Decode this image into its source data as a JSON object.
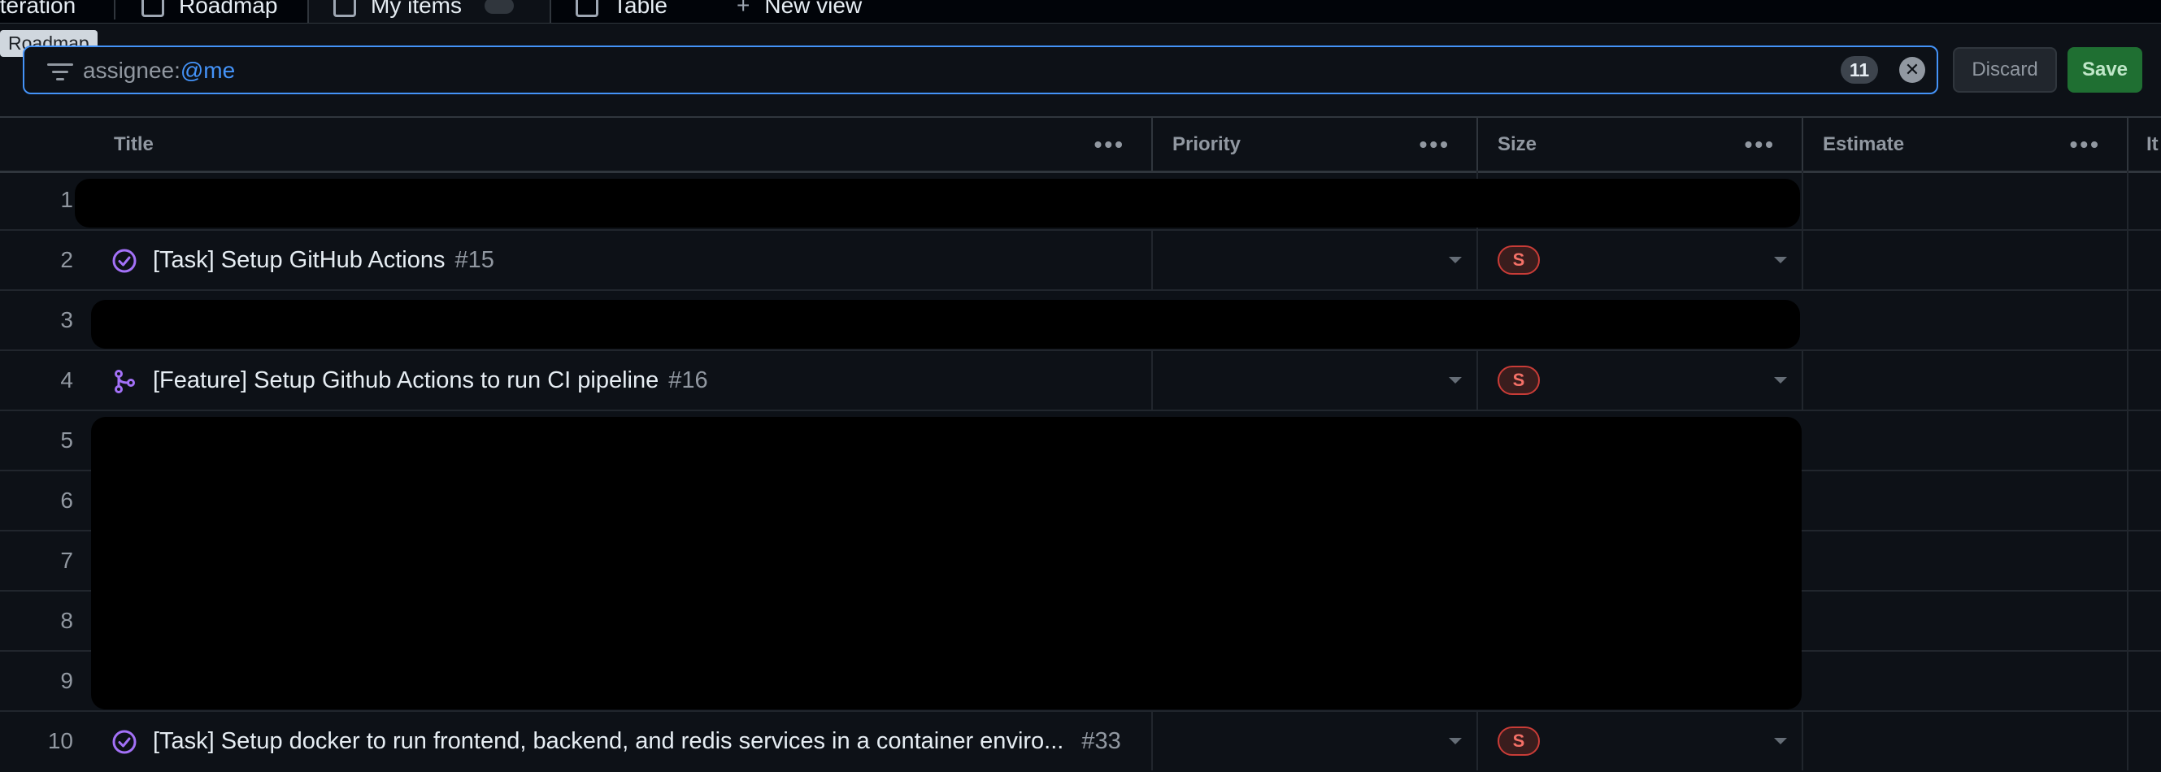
{
  "tabs": {
    "iteration": "Iteration",
    "roadmap": "Roadmap",
    "my_items": "My items",
    "table": "Table",
    "new_view": "New view"
  },
  "tooltip": "Roadmap",
  "filter": {
    "key": "assignee:",
    "value": "@me",
    "count": "11"
  },
  "actions": {
    "discard": "Discard",
    "save": "Save"
  },
  "columns": {
    "title": "Title",
    "priority": "Priority",
    "size": "Size",
    "estimate": "Estimate",
    "iteration_partial": "It"
  },
  "column_menu_glyph": "•••",
  "rows": [
    {
      "num": "1",
      "redacted": true
    },
    {
      "num": "2",
      "title": "[Task] Setup GitHub Actions",
      "issue": "#15",
      "status_icon": "issue-closed-icon",
      "size": "S"
    },
    {
      "num": "3",
      "redacted": true
    },
    {
      "num": "4",
      "title": "[Feature] Setup Github Actions to run CI pipeline",
      "issue": "#16",
      "status_icon": "pull-request-merged-icon",
      "size": "S"
    },
    {
      "num": "5",
      "redacted": true
    },
    {
      "num": "6",
      "redacted": true
    },
    {
      "num": "7",
      "redacted": true
    },
    {
      "num": "8",
      "redacted": true
    },
    {
      "num": "9",
      "redacted": true
    },
    {
      "num": "10",
      "title": "[Task] Setup docker to run frontend, backend, and redis services in a container enviro...",
      "issue": "#33",
      "status_icon": "issue-closed-icon",
      "size": "S"
    }
  ],
  "colors": {
    "accent": "#4493f8",
    "done_purple": "#a371f7",
    "size_badge": "#f47067",
    "save_green": "#1f6f32"
  }
}
